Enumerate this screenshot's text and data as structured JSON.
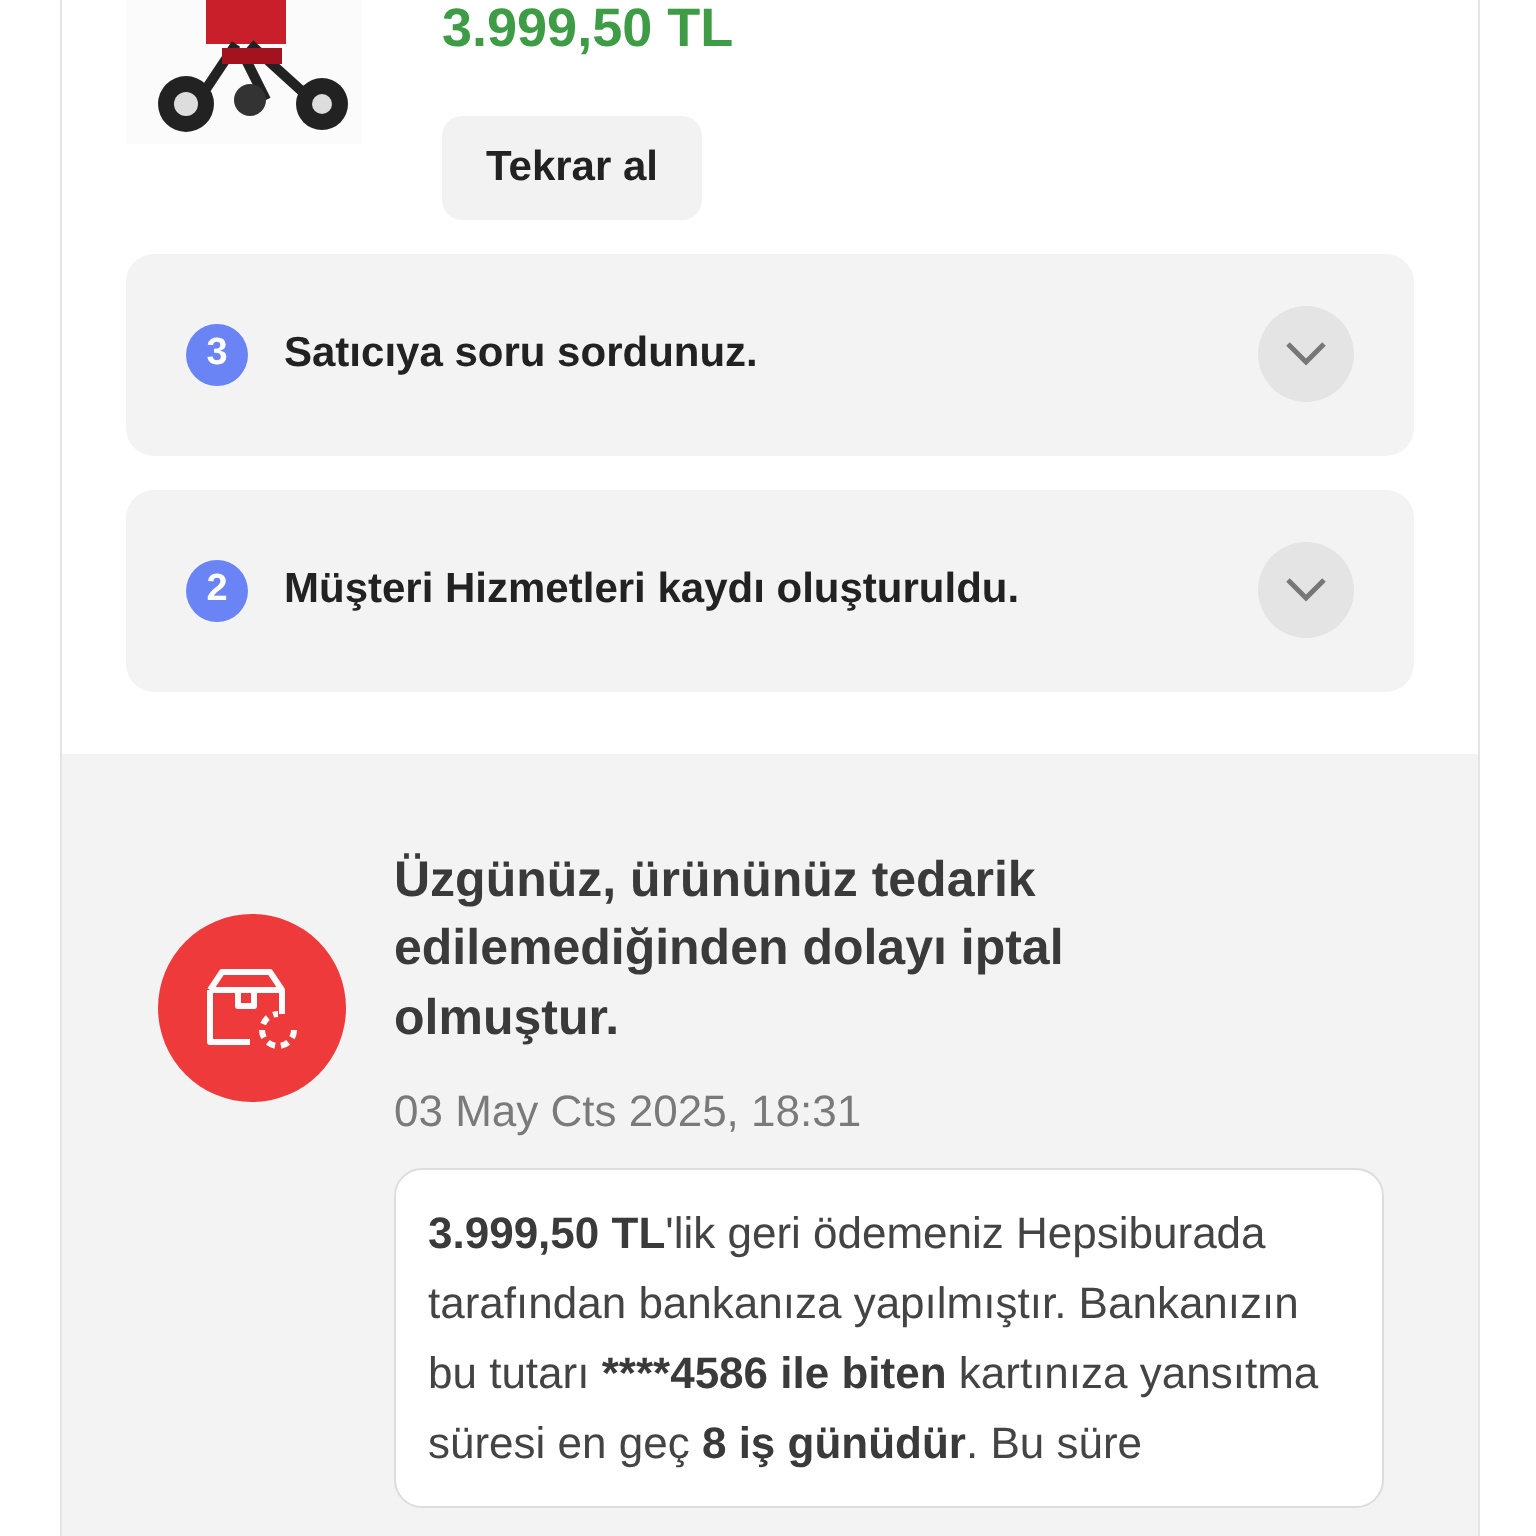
{
  "product": {
    "price": "3.999,50 TL",
    "reorder_button": "Tekrar al"
  },
  "events": [
    {
      "number": "3",
      "text": "Satıcıya soru sordunuz.",
      "expanded": false
    },
    {
      "number": "2",
      "text": "Müşteri Hizmetleri kaydı oluşturuldu.",
      "expanded": false
    }
  ],
  "cancellation": {
    "title": "Üzgünüz, ürününüz tedarik edilemediğinden dolayı iptal olmuştur.",
    "date": "03 May Cts 2025, 18:31",
    "message": [
      {
        "text": "3.999,50 TL",
        "bold": true
      },
      {
        "text": "'lik geri ödemeniz Hepsiburada tarafından bankanıza yapılmıştır. Bankanızın bu tutarı ",
        "bold": false
      },
      {
        "text": "****4586 ile biten",
        "bold": true
      },
      {
        "text": " kartınıza yansıtma süresi en geç ",
        "bold": false
      },
      {
        "text": "8 iş günüdür",
        "bold": true
      },
      {
        "text": ". Bu süre",
        "bold": false
      }
    ]
  }
}
